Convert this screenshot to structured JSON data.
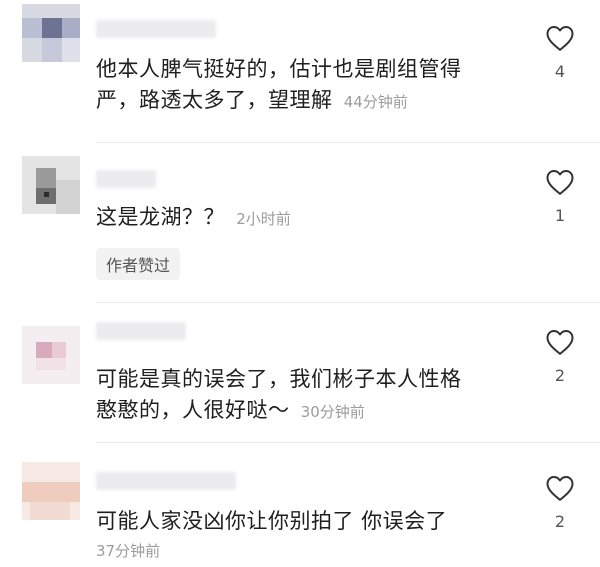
{
  "comments": [
    {
      "text_line1": "他本人脾气挺好的，估计也是剧组管得",
      "text_line2": "严，路透太多了，望理解",
      "time": "44分钟前",
      "like_count": "4"
    },
    {
      "text_line1": "这是龙湖？？",
      "time": "2小时前",
      "like_count": "1",
      "author_tag": "作者赞过"
    },
    {
      "text_line1": "可能是真的误会了，我们彬子本人性格",
      "text_line2": "憨憨的，人很好哒～",
      "time": "30分钟前",
      "like_count": "2"
    },
    {
      "text_line1": "可能人家没凶你让你别拍了 你误会了",
      "time": "37分钟前",
      "like_count": "2"
    }
  ],
  "icons": {
    "like": "heart-outline-icon"
  },
  "colors": {
    "text": "#1f1f1f",
    "time": "#9c9c9c",
    "separator": "#ececec"
  }
}
